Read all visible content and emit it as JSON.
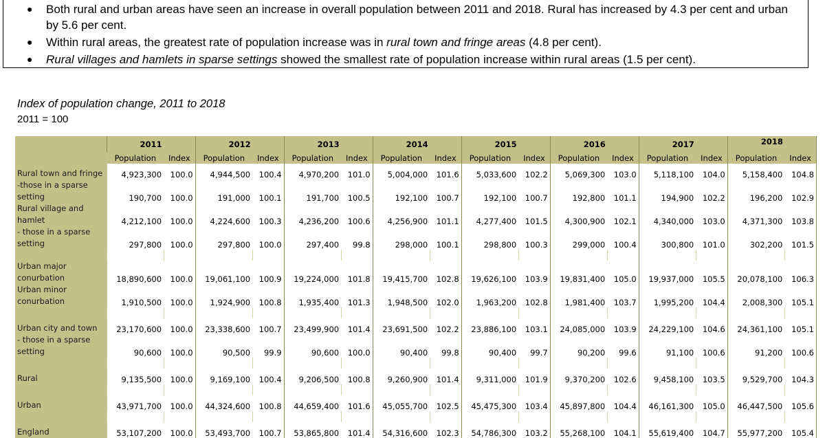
{
  "bullets": [
    {
      "parts": [
        {
          "text": "Both rural and urban areas have seen an increase in overall population between 2011 and 2018. Rural has increased by 4.3 per cent and urban by 5.6 per cent.",
          "italic": false
        }
      ]
    },
    {
      "parts": [
        {
          "text": "Within rural areas, the greatest rate of population increase was in ",
          "italic": false
        },
        {
          "text": "rural town and fringe areas",
          "italic": true
        },
        {
          "text": " (4.8 per cent).",
          "italic": false
        }
      ]
    },
    {
      "parts": [
        {
          "text": "Rural villages and hamlets in sparse settings",
          "italic": true
        },
        {
          "text": " showed the smallest rate of population increase within rural areas (1.5 per cent).",
          "italic": false
        }
      ]
    }
  ],
  "heading": "Index of population change, 2011 to 2018",
  "subheading": "2011  = 100",
  "table": {
    "years": [
      "2011",
      "2012",
      "2013",
      "2014",
      "2015",
      "2016",
      "2017",
      "2018"
    ],
    "col_population": "Population",
    "col_index": "Index",
    "rows": [
      {
        "label": [
          "Rural town and fringe"
        ],
        "values": [
          [
            "4,923,300",
            "100.0"
          ],
          [
            "4,944,500",
            "100.4"
          ],
          [
            "4,970,200",
            "101.0"
          ],
          [
            "5,004,000",
            "101.6"
          ],
          [
            "5,033,600",
            "102.2"
          ],
          [
            "5,069,300",
            "103.0"
          ],
          [
            "5,118,100",
            "104.0"
          ],
          [
            "5,158,400",
            "104.8"
          ]
        ]
      },
      {
        "label": [
          " -those in a sparse",
          "setting"
        ],
        "values": [
          [
            "190,700",
            "100.0"
          ],
          [
            "191,000",
            "100.1"
          ],
          [
            "191,700",
            "100.5"
          ],
          [
            "192,100",
            "100.7"
          ],
          [
            "192,100",
            "100.7"
          ],
          [
            "192,800",
            "101.1"
          ],
          [
            "194,900",
            "102.2"
          ],
          [
            "196,200",
            "102.9"
          ]
        ]
      },
      {
        "label": [
          "Rural village and",
          "hamlet"
        ],
        "values": [
          [
            "4,212,100",
            "100.0"
          ],
          [
            "4,224,600",
            "100.3"
          ],
          [
            "4,236,200",
            "100.6"
          ],
          [
            "4,256,900",
            "101.1"
          ],
          [
            "4,277,400",
            "101.5"
          ],
          [
            "4,300,900",
            "102.1"
          ],
          [
            "4,340,000",
            "103.0"
          ],
          [
            "4,371,300",
            "103.8"
          ]
        ]
      },
      {
        "label": [
          " - those in a sparse",
          "setting"
        ],
        "values": [
          [
            "297,800",
            "100.0"
          ],
          [
            "297,800",
            "100.0"
          ],
          [
            "297,400",
            "99.8"
          ],
          [
            "298,000",
            "100.1"
          ],
          [
            "298,800",
            "100.3"
          ],
          [
            "299,000",
            "100.4"
          ],
          [
            "300,800",
            "101.0"
          ],
          [
            "302,200",
            "101.5"
          ]
        ]
      },
      {
        "spacer": true
      },
      {
        "label": [
          "Urban major",
          "conurbation"
        ],
        "values": [
          [
            "18,890,600",
            "100.0"
          ],
          [
            "19,061,100",
            "100.9"
          ],
          [
            "19,224,000",
            "101.8"
          ],
          [
            "19,415,700",
            "102.8"
          ],
          [
            "19,626,100",
            "103.9"
          ],
          [
            "19,831,400",
            "105.0"
          ],
          [
            "19,937,000",
            "105.5"
          ],
          [
            "20,078,100",
            "106.3"
          ]
        ]
      },
      {
        "label": [
          "Urban minor",
          "conurbation"
        ],
        "values": [
          [
            "1,910,500",
            "100.0"
          ],
          [
            "1,924,900",
            "100.8"
          ],
          [
            "1,935,400",
            "101.3"
          ],
          [
            "1,948,500",
            "102.0"
          ],
          [
            "1,963,200",
            "102.8"
          ],
          [
            "1,981,400",
            "103.7"
          ],
          [
            "1,995,200",
            "104.4"
          ],
          [
            "2,008,300",
            "105.1"
          ]
        ]
      },
      {
        "spacer": true
      },
      {
        "label": [
          "Urban city and town"
        ],
        "values": [
          [
            "23,170,600",
            "100.0"
          ],
          [
            "23,338,600",
            "100.7"
          ],
          [
            "23,499,900",
            "101.4"
          ],
          [
            "23,691,500",
            "102.2"
          ],
          [
            "23,886,100",
            "103.1"
          ],
          [
            "24,085,000",
            "103.9"
          ],
          [
            "24,229,100",
            "104.6"
          ],
          [
            "24,361,100",
            "105.1"
          ]
        ]
      },
      {
        "label": [
          " - those in a sparse",
          "setting"
        ],
        "values": [
          [
            "90,600",
            "100.0"
          ],
          [
            "90,500",
            "99.9"
          ],
          [
            "90,600",
            "100.0"
          ],
          [
            "90,400",
            "99.8"
          ],
          [
            "90,400",
            "99.7"
          ],
          [
            "90,200",
            "99.6"
          ],
          [
            "91,100",
            "100.6"
          ],
          [
            "91,200",
            "100.6"
          ]
        ]
      },
      {
        "spacer": true
      },
      {
        "label": [
          "Rural"
        ],
        "values": [
          [
            "9,135,500",
            "100.0"
          ],
          [
            "9,169,100",
            "100.4"
          ],
          [
            "9,206,500",
            "100.8"
          ],
          [
            "9,260,900",
            "101.4"
          ],
          [
            "9,311,000",
            "101.9"
          ],
          [
            "9,370,200",
            "102.6"
          ],
          [
            "9,458,100",
            "103.5"
          ],
          [
            "9,529,700",
            "104.3"
          ]
        ]
      },
      {
        "spacer": true
      },
      {
        "label": [
          "Urban"
        ],
        "values": [
          [
            "43,971,700",
            "100.0"
          ],
          [
            "44,324,600",
            "100.8"
          ],
          [
            "44,659,400",
            "101.6"
          ],
          [
            "45,055,700",
            "102.5"
          ],
          [
            "45,475,300",
            "103.4"
          ],
          [
            "45,897,800",
            "104.4"
          ],
          [
            "46,161,300",
            "105.0"
          ],
          [
            "46,447,500",
            "105.6"
          ]
        ]
      },
      {
        "spacer": true
      },
      {
        "label": [
          "England"
        ],
        "values": [
          [
            "53,107,200",
            "100.0"
          ],
          [
            "53,493,700",
            "100.7"
          ],
          [
            "53,865,800",
            "101.4"
          ],
          [
            "54,316,600",
            "102.3"
          ],
          [
            "54,786,300",
            "103.2"
          ],
          [
            "55,268,100",
            "104.1"
          ],
          [
            "55,619,400",
            "104.7"
          ],
          [
            "55,977,200",
            "105.4"
          ]
        ]
      }
    ]
  },
  "colors": {
    "label_band": "#c4c08a",
    "separator": "#8c8850"
  }
}
